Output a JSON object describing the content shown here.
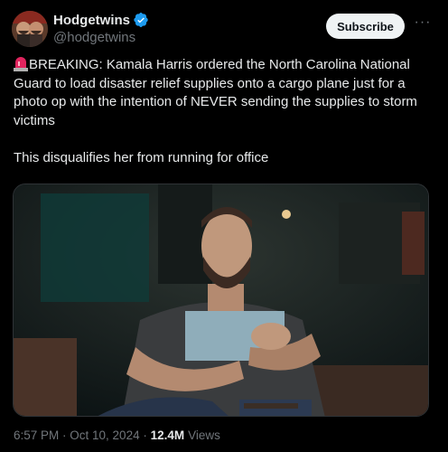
{
  "author": {
    "display_name": "Hodgetwins",
    "handle": "@hodgetwins",
    "verified": true
  },
  "actions": {
    "subscribe_label": "Subscribe",
    "more_label": "···"
  },
  "tweet": {
    "line1": "BREAKING: Kamala Harris ordered the North Carolina National Guard to load disaster relief supplies onto a cargo plane just for a photo op with the intention of NEVER sending the supplies to storm victims",
    "line2": "This disqualifies her from running for office",
    "emoji": "siren-icon"
  },
  "meta": {
    "time": "6:57 PM",
    "separator": " · ",
    "date": "Oct 10, 2024",
    "views_count": "12.4M",
    "views_label": "Views"
  },
  "colors": {
    "background": "#000000",
    "text": "#e7e9ea",
    "muted": "#71767b",
    "verified": "#1d9bf0",
    "button_bg": "#eff3f4"
  }
}
